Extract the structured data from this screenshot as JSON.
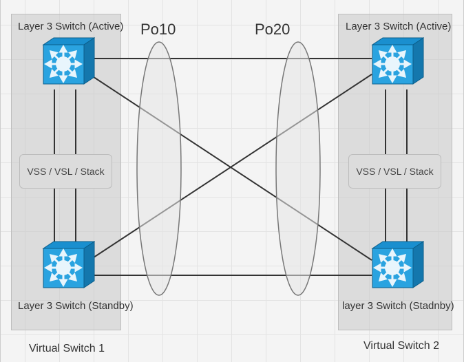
{
  "labels": {
    "vs1_title": "Virtual Switch 1",
    "vs2_title": "Virtual Switch 2",
    "sw1a": "Layer 3 Switch (Active)",
    "sw1s": "Layer 3 Switch (Standby)",
    "sw2a": "Layer 3 Switch (Active)",
    "sw2s": "layer 3  Switch (Stadnby)",
    "stack1": "VSS / VSL / Stack",
    "stack2": "VSS / VSL / Stack",
    "po10": "Po10",
    "po20": "Po20"
  },
  "chart_data": {
    "type": "diagram",
    "title": "Dual Virtual Switch Port-Channel Topology",
    "nodes": [
      {
        "id": "sw1a",
        "group": "Virtual Switch 1",
        "role": "Layer 3 Switch (Active)"
      },
      {
        "id": "sw1s",
        "group": "Virtual Switch 1",
        "role": "Layer 3 Switch (Standby)"
      },
      {
        "id": "sw2a",
        "group": "Virtual Switch 2",
        "role": "Layer 3 Switch (Active)"
      },
      {
        "id": "sw2s",
        "group": "Virtual Switch 2",
        "role": "Layer 3 Switch (Standby)"
      }
    ],
    "groups": [
      {
        "id": "vs1",
        "label": "Virtual Switch 1",
        "stack_label": "VSS / VSL / Stack",
        "members": [
          "sw1a",
          "sw1s"
        ]
      },
      {
        "id": "vs2",
        "label": "Virtual Switch 2",
        "stack_label": "VSS / VSL / Stack",
        "members": [
          "sw2a",
          "sw2s"
        ]
      }
    ],
    "intra_group_links": [
      {
        "from": "sw1a",
        "to": "sw1s",
        "count": 2,
        "via": "VSS / VSL / Stack"
      },
      {
        "from": "sw2a",
        "to": "sw2s",
        "count": 2,
        "via": "VSS / VSL / Stack"
      }
    ],
    "port_channels": [
      {
        "id": "Po10",
        "side": "Virtual Switch 1",
        "members": [
          {
            "from": "sw1a",
            "to": "sw2a"
          },
          {
            "from": "sw1a",
            "to": "sw2s"
          },
          {
            "from": "sw1s",
            "to": "sw2a"
          },
          {
            "from": "sw1s",
            "to": "sw2s"
          }
        ]
      },
      {
        "id": "Po20",
        "side": "Virtual Switch 2",
        "members": [
          {
            "from": "sw2a",
            "to": "sw1a"
          },
          {
            "from": "sw2a",
            "to": "sw1s"
          },
          {
            "from": "sw2s",
            "to": "sw1a"
          },
          {
            "from": "sw2s",
            "to": "sw1s"
          }
        ]
      }
    ]
  }
}
